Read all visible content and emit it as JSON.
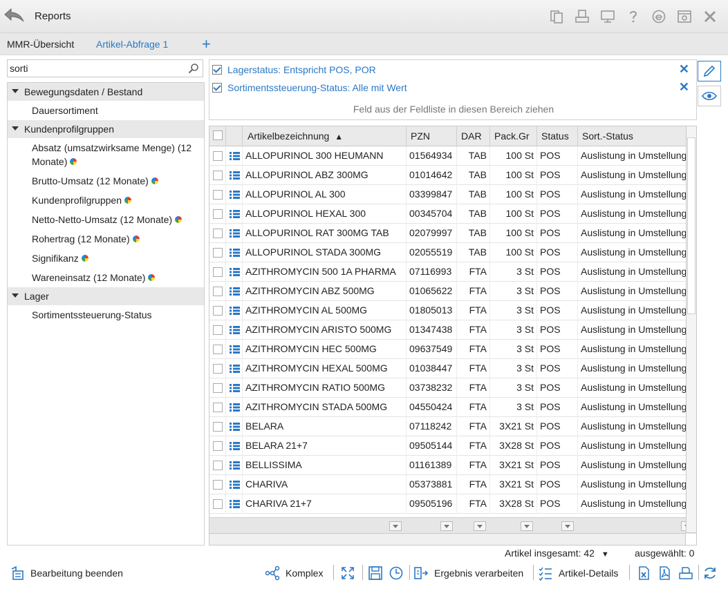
{
  "app": {
    "title": "Reports"
  },
  "tabs": [
    {
      "label": "MMR-Übersicht",
      "active": false
    },
    {
      "label": "Artikel-Abfrage 1",
      "active": true
    }
  ],
  "tab_add_label": "+",
  "search": {
    "value": "sorti"
  },
  "tree": {
    "groups": [
      {
        "label": "Bewegungsdaten / Bestand",
        "items": [
          {
            "label": "Dauersortiment",
            "calc": false
          }
        ]
      },
      {
        "label": "Kundenprofilgruppen",
        "items": [
          {
            "label": "Absatz (umsatzwirksame Menge) (12 Monate)",
            "calc": true
          },
          {
            "label": "Brutto-Umsatz (12 Monate)",
            "calc": true
          },
          {
            "label": "Kundenprofilgruppen",
            "calc": true
          },
          {
            "label": "Netto-Netto-Umsatz (12 Monate)",
            "calc": true
          },
          {
            "label": "Rohertrag (12 Monate)",
            "calc": true
          },
          {
            "label": "Signifikanz",
            "calc": true
          },
          {
            "label": "Wareneinsatz (12 Monate)",
            "calc": true
          }
        ]
      },
      {
        "label": "Lager",
        "items": [
          {
            "label": "Sortimentssteuerung-Status",
            "calc": false
          }
        ]
      }
    ]
  },
  "filters": {
    "rows": [
      {
        "label": "Lagerstatus: Entspricht POS, POR",
        "checked": true
      },
      {
        "label": "Sortimentssteuerung-Status: Alle mit Wert",
        "checked": true
      }
    ],
    "hint": "Feld aus der Feldliste in diesen Bereich ziehen"
  },
  "grid": {
    "columns": [
      "Artikelbezeichnung",
      "PZN",
      "DAR",
      "Pack.Gr",
      "Status",
      "Sort.-Status"
    ],
    "sort_indicator": "▲",
    "rows": [
      [
        "ALLOPURINOL 300 HEUMANN",
        "01564934",
        "TAB",
        "100 St",
        "POS",
        "Auslistung in Umstellung"
      ],
      [
        "ALLOPURINOL ABZ 300MG",
        "01014642",
        "TAB",
        "100 St",
        "POS",
        "Auslistung in Umstellung"
      ],
      [
        "ALLOPURINOL AL 300",
        "03399847",
        "TAB",
        "100 St",
        "POS",
        "Auslistung in Umstellung"
      ],
      [
        "ALLOPURINOL HEXAL 300",
        "00345704",
        "TAB",
        "100 St",
        "POS",
        "Auslistung in Umstellung"
      ],
      [
        "ALLOPURINOL RAT 300MG TAB",
        "02079997",
        "TAB",
        "100 St",
        "POS",
        "Auslistung in Umstellung"
      ],
      [
        "ALLOPURINOL STADA 300MG",
        "02055519",
        "TAB",
        "100 St",
        "POS",
        "Auslistung in Umstellung"
      ],
      [
        "AZITHROMYCIN 500 1A PHARMA",
        "07116993",
        "FTA",
        "3 St",
        "POS",
        "Auslistung in Umstellung"
      ],
      [
        "AZITHROMYCIN ABZ 500MG",
        "01065622",
        "FTA",
        "3 St",
        "POS",
        "Auslistung in Umstellung"
      ],
      [
        "AZITHROMYCIN AL 500MG",
        "01805013",
        "FTA",
        "3 St",
        "POS",
        "Auslistung in Umstellung"
      ],
      [
        "AZITHROMYCIN ARISTO 500MG",
        "01347438",
        "FTA",
        "3 St",
        "POS",
        "Auslistung in Umstellung"
      ],
      [
        "AZITHROMYCIN HEC 500MG",
        "09637549",
        "FTA",
        "3 St",
        "POS",
        "Auslistung in Umstellung"
      ],
      [
        "AZITHROMYCIN HEXAL 500MG",
        "01038447",
        "FTA",
        "3 St",
        "POS",
        "Auslistung in Umstellung"
      ],
      [
        "AZITHROMYCIN RATIO 500MG",
        "03738232",
        "FTA",
        "3 St",
        "POS",
        "Auslistung in Umstellung"
      ],
      [
        "AZITHROMYCIN STADA 500MG",
        "04550424",
        "FTA",
        "3 St",
        "POS",
        "Auslistung in Umstellung"
      ],
      [
        "BELARA",
        "07118242",
        "FTA",
        "3X21 St",
        "POS",
        "Auslistung in Umstellung"
      ],
      [
        "BELARA 21+7",
        "09505144",
        "FTA",
        "3X28 St",
        "POS",
        "Auslistung in Umstellung"
      ],
      [
        "BELLISSIMA",
        "01161389",
        "FTA",
        "3X21 St",
        "POS",
        "Auslistung in Umstellung"
      ],
      [
        "CHARIVA",
        "05373881",
        "FTA",
        "3X21 St",
        "POS",
        "Auslistung in Umstellung"
      ],
      [
        "CHARIVA 21+7",
        "09505196",
        "FTA",
        "3X28 St",
        "POS",
        "Auslistung in Umstellung"
      ]
    ]
  },
  "status": {
    "total": "Artikel insgesamt: 42",
    "selected": "ausgewählt: 0"
  },
  "footer": {
    "end_edit": "Bearbeitung beenden",
    "complex": "Komplex",
    "process_result": "Ergebnis verarbeiten",
    "article_details": "Artikel-Details"
  },
  "colors": {
    "accent": "#2a78c4",
    "header_bg": "#eaeaea",
    "group_bg": "#e8e8e8"
  }
}
